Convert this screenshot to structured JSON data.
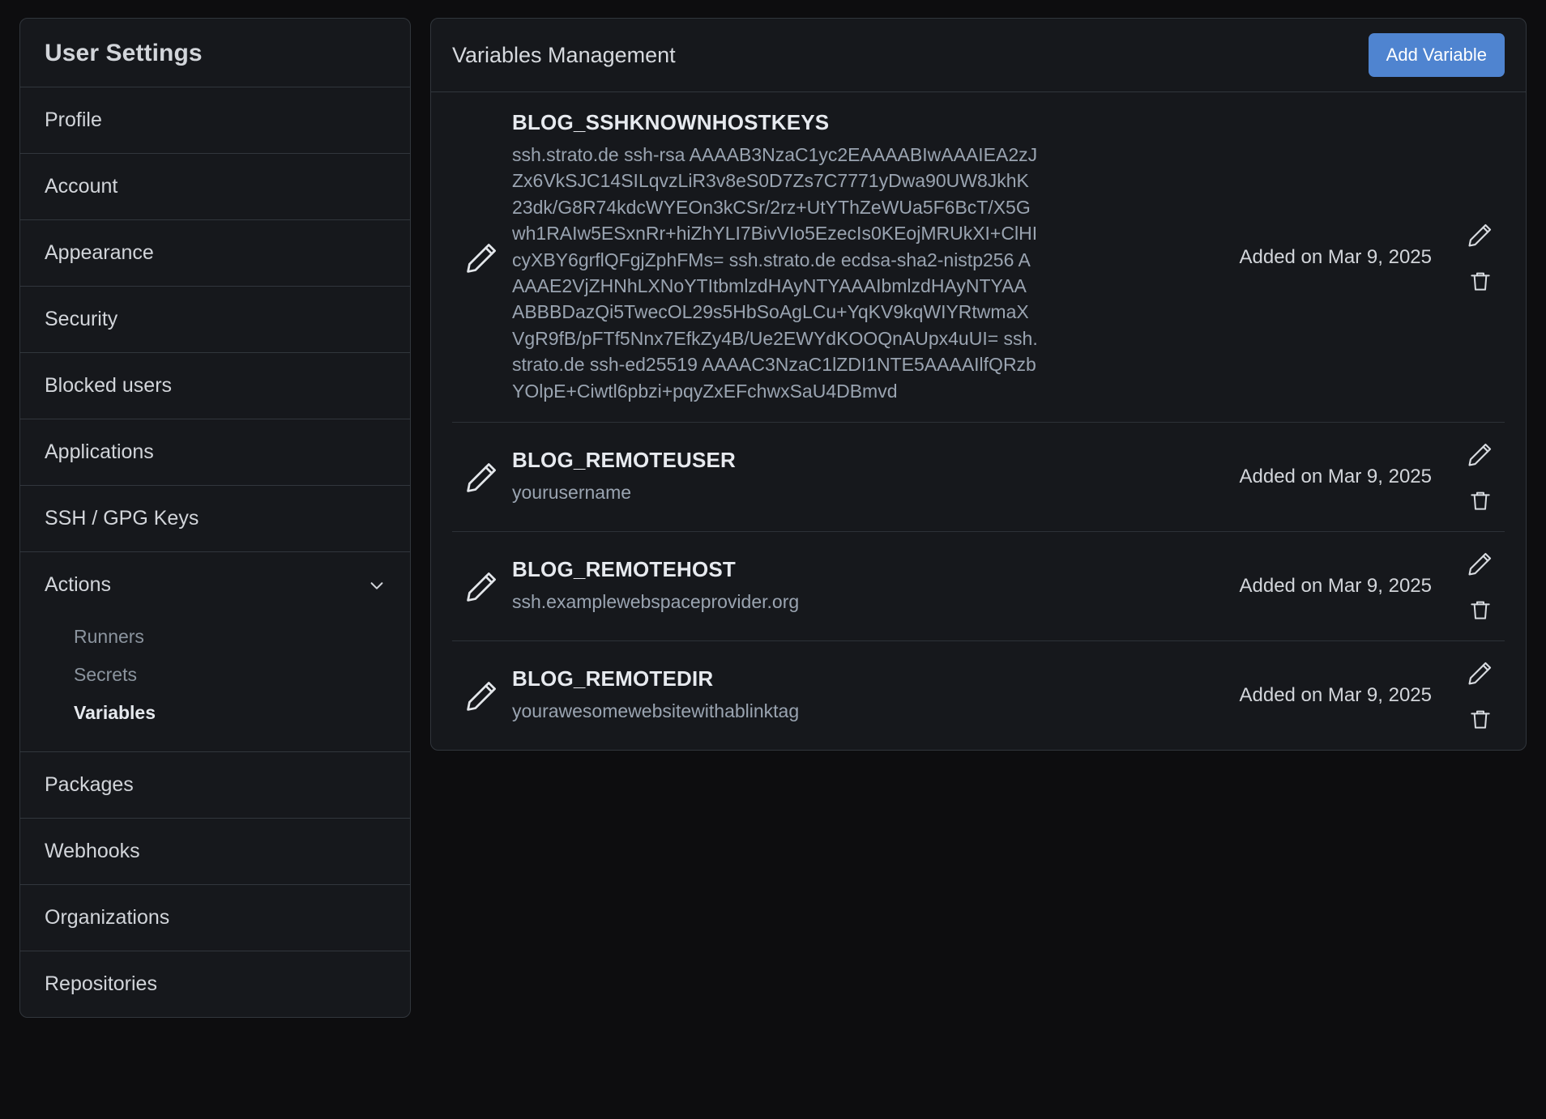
{
  "sidebar": {
    "title": "User Settings",
    "items": [
      {
        "label": "Profile"
      },
      {
        "label": "Account"
      },
      {
        "label": "Appearance"
      },
      {
        "label": "Security"
      },
      {
        "label": "Blocked users"
      },
      {
        "label": "Applications"
      },
      {
        "label": "SSH / GPG Keys"
      }
    ],
    "actions_group": {
      "label": "Actions",
      "expanded": true,
      "chevron_icon": "chevron-down-icon",
      "sub_items": [
        {
          "label": "Runners",
          "active": false
        },
        {
          "label": "Secrets",
          "active": false
        },
        {
          "label": "Variables",
          "active": true
        }
      ]
    },
    "items_after": [
      {
        "label": "Packages"
      },
      {
        "label": "Webhooks"
      },
      {
        "label": "Organizations"
      },
      {
        "label": "Repositories"
      }
    ]
  },
  "main": {
    "title": "Variables Management",
    "add_button_label": "Add Variable",
    "accent_color": "#4f84d0",
    "variables": [
      {
        "name": "BLOG_SSHKNOWNHOSTKEYS",
        "value": "ssh.strato.de ssh-rsa AAAAB3NzaC1yc2EAAAABIwAAAIEA2zJZx6VkSJC14SILqvzLiR3v8eS0D7Zs7C7771yDwa90UW8JkhK23dk/G8R74kdcWYEOn3kCSr/2rz+UtYThZeWUa5F6BcT/X5Gwh1RAIw5ESxnRr+hiZhYLI7BivVIo5EzecIs0KEojMRUkXI+ClHIcyXBY6grflQFgjZphFMs= ssh.strato.de ecdsa-sha2-nistp256 AAAAE2VjZHNhLXNoYTItbmlzdHAyNTYAAAIbmlzdHAyNTYAAABBBDazQi5TwecOL29s5HbSoAgLCu+YqKV9kqWIYRtwmaXVgR9fB/pFTf5Nnx7EfkZy4B/Ue2EWYdKOOQnAUpx4uUI= ssh.strato.de ssh-ed25519 AAAAC3NzaC1lZDI1NTE5AAAAIlfQRzbYOlpE+Ciwtl6pbzi+pqyZxEFchwxSaU4DBmvd",
        "added_label": "Added on Mar 9, 2025",
        "edit_icon": "pencil-icon",
        "delete_icon": "trash-icon"
      },
      {
        "name": "BLOG_REMOTEUSER",
        "value": "yourusername",
        "added_label": "Added on Mar 9, 2025",
        "edit_icon": "pencil-icon",
        "delete_icon": "trash-icon"
      },
      {
        "name": "BLOG_REMOTEHOST",
        "value": "ssh.examplewebspaceprovider.org",
        "added_label": "Added on Mar 9, 2025",
        "edit_icon": "pencil-icon",
        "delete_icon": "trash-icon"
      },
      {
        "name": "BLOG_REMOTEDIR",
        "value": "yourawesomewebsitewithablinktag",
        "added_label": "Added on Mar 9, 2025",
        "edit_icon": "pencil-icon",
        "delete_icon": "trash-icon"
      }
    ]
  }
}
